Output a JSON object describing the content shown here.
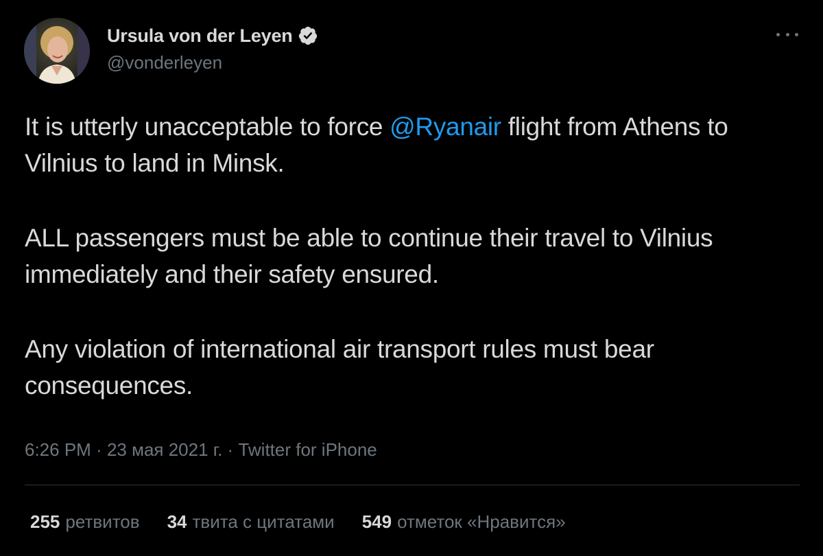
{
  "user": {
    "display_name": "Ursula von der Leyen",
    "handle": "@vonderleyen",
    "verified": true,
    "avatar_icon": "profile-photo"
  },
  "tweet": {
    "line1_before": "It is utterly unacceptable to force ",
    "mention": "@Ryanair",
    "line1_after": " flight from Athens to Vilnius to land in Minsk.",
    "paragraph2": "ALL passengers must be able to continue their travel to Vilnius immediately and their safety ensured.",
    "paragraph3": "Any violation of international air transport rules must bear consequences."
  },
  "meta": {
    "time": "6:26 PM",
    "date": "23 мая 2021 г.",
    "source": "Twitter for iPhone",
    "separator": " · "
  },
  "stats": {
    "retweets_count": "255",
    "retweets_label": "ретвитов",
    "quotes_count": "34",
    "quotes_label": "твита с цитатами",
    "likes_count": "549",
    "likes_label": "отметок «Нравится»"
  },
  "colors": {
    "background": "#000000",
    "text": "#d9d9d9",
    "secondary": "#6e767d",
    "link": "#1d9bf0",
    "divider": "#2f3336"
  }
}
